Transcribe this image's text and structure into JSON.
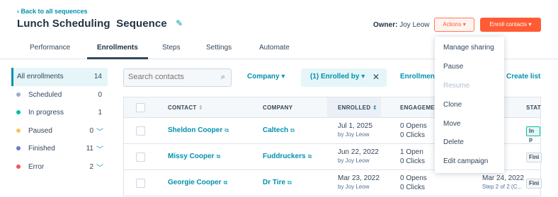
{
  "header": {
    "back_link": "Back to all sequences",
    "title_part1": "Lunch Scheduling",
    "title_part2": "Sequence",
    "owner_label": "Owner:",
    "owner_name": "Joy Leow",
    "actions_label": "Actions ▾",
    "enroll_label": "Enroll contacts ▾"
  },
  "tabs": [
    {
      "label": "Performance"
    },
    {
      "label": "Enrollments"
    },
    {
      "label": "Steps"
    },
    {
      "label": "Settings"
    },
    {
      "label": "Automate"
    }
  ],
  "sidebar": {
    "items": [
      {
        "label": "All enrollments",
        "count": "14",
        "color": ""
      },
      {
        "label": "Scheduled",
        "count": "0",
        "color": "#99afc4"
      },
      {
        "label": "In progress",
        "count": "1",
        "color": "#00bda5"
      },
      {
        "label": "Paused",
        "count": "0",
        "color": "#f5c26b"
      },
      {
        "label": "Finished",
        "count": "11",
        "color": "#6a78d1"
      },
      {
        "label": "Error",
        "count": "2",
        "color": "#f2545b"
      }
    ]
  },
  "filters": {
    "search_placeholder": "Search contacts",
    "company": "Company ▾",
    "enrolled_by": "(1) Enrolled by ▾",
    "enrollment": "Enrollmen",
    "create_list": "Create list"
  },
  "table": {
    "headers": {
      "contact": "CONTACT",
      "company": "COMPANY",
      "enrolled": "ENROLLED",
      "engagement": "ENGAGEMEN",
      "status": "STAT"
    },
    "rows": [
      {
        "contact": "Sheldon Cooper",
        "company": "Caltech",
        "date": "Jul 1, 2025",
        "by": "by Joy Leow",
        "opens": "0 Opens",
        "clicks": "0 Clicks",
        "date2": "",
        "step": "",
        "status": "In p"
      },
      {
        "contact": "Missy Cooper",
        "company": "Fuddruckers",
        "date": "Jun 22, 2022",
        "by": "by Joy Leow",
        "opens": "1 Open",
        "clicks": "0 Clicks",
        "date2": "",
        "step": "",
        "status": "Fini"
      },
      {
        "contact": "Georgie Cooper",
        "company": "Dr Tire",
        "date": "Mar 23, 2022",
        "by": "by Joy Leow",
        "opens": "0 Opens",
        "clicks": "0 Clicks",
        "date2": "Mar 24, 2022",
        "step": "Step 2 of 2 (C...",
        "status": "Fini"
      }
    ]
  },
  "actions_menu": {
    "items": [
      {
        "label": "Manage sharing"
      },
      {
        "label": "Pause"
      },
      {
        "label": "Resume"
      },
      {
        "label": "Clone"
      },
      {
        "label": "Move"
      },
      {
        "label": "Delete"
      },
      {
        "label": "Edit campaign"
      }
    ]
  }
}
